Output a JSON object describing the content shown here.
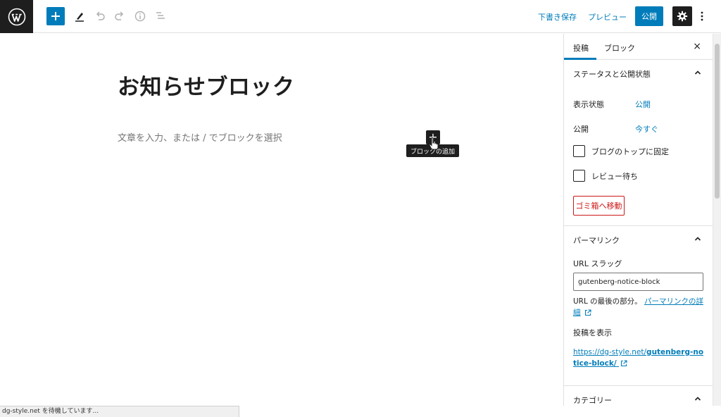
{
  "toolbar": {
    "logo_icon": "wordpress-logo-icon",
    "add_icon": "plus-icon",
    "tools_icon": "pen-icon",
    "undo_icon": "undo-icon",
    "redo_icon": "redo-icon",
    "info_icon": "info-icon",
    "outline_icon": "list-view-icon",
    "save_draft": "下書き保存",
    "preview": "プレビュー",
    "publish": "公開",
    "settings_icon": "gear-icon",
    "more_icon": "more-vertical-icon"
  },
  "editor": {
    "title": "お知らせブロック",
    "placeholder": "文章を入力、または / でブロックを選択",
    "inserter_label": "+",
    "tooltip": "ブロックの追加"
  },
  "sidebar": {
    "tabs": [
      {
        "label": "投稿",
        "active": true
      },
      {
        "label": "ブロック",
        "active": false
      }
    ],
    "close_label": "×",
    "status_panel": {
      "title": "ステータスと公開状態",
      "visibility_label": "表示状態",
      "visibility_value": "公開",
      "publish_label": "公開",
      "publish_value": "今すぐ",
      "sticky_label": "ブログのトップに固定",
      "pending_label": "レビュー待ち",
      "trash_label": "ゴミ箱へ移動"
    },
    "permalink_panel": {
      "title": "パーマリンク",
      "slug_label": "URL スラッグ",
      "slug_value": "gutenberg-notice-block",
      "help_prefix": "URL の最後の部分。",
      "help_link": "パーマリンクの詳細",
      "view_label": "投稿を表示",
      "url_prefix": "https://dg-style.net/",
      "url_slug": "gutenberg-notice-block/"
    },
    "category_panel": {
      "title": "カテゴリー"
    }
  },
  "statusbar": {
    "text": "dg-style.net を待機しています..."
  },
  "colors": {
    "accent": "#007cba",
    "dark": "#1e1e1e",
    "danger": "#cc1818"
  }
}
